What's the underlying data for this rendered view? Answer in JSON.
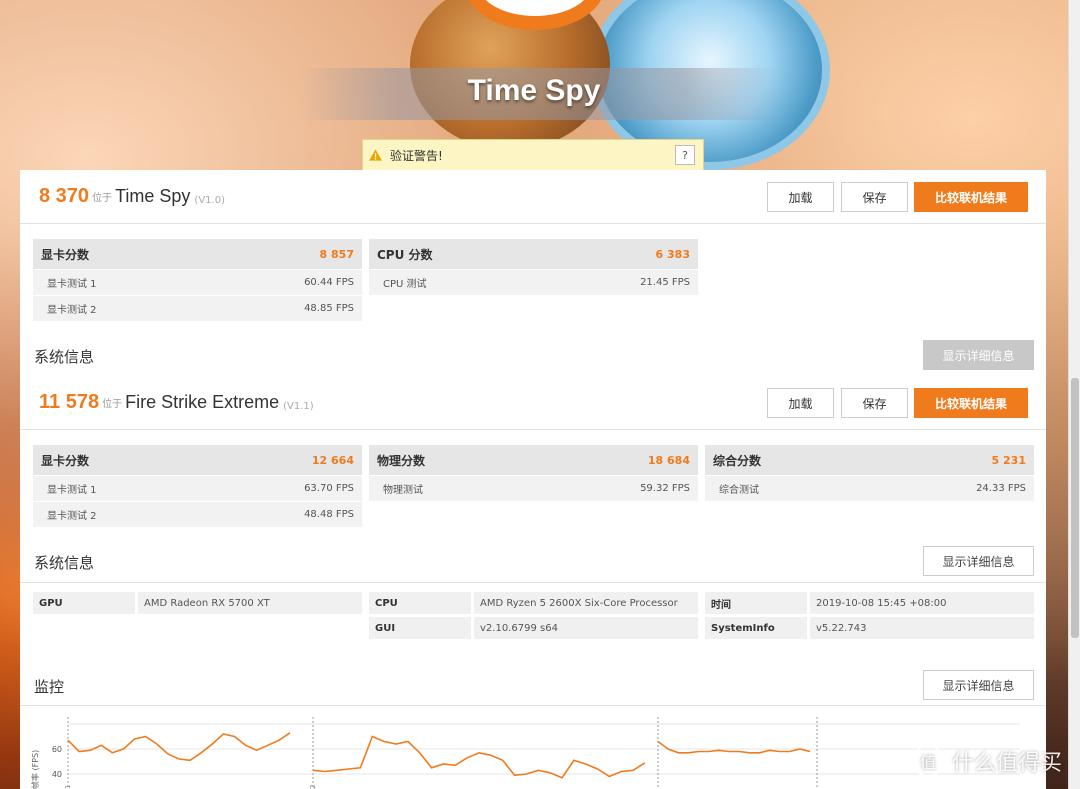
{
  "hero": {
    "title": "Time Spy"
  },
  "warning": {
    "text": "验证警告!",
    "help": "?"
  },
  "panels": [
    {
      "score": "8 370",
      "position_word": "位于",
      "test_name": "Time Spy",
      "version": "(V1.0)",
      "buttons": {
        "load": "加载",
        "save": "保存",
        "compare": "比较联机结果"
      },
      "score_boxes": [
        {
          "title": "显卡分数",
          "value": "8 857",
          "rows": [
            {
              "label": "显卡测试 1",
              "value": "60.44 FPS"
            },
            {
              "label": "显卡测试 2",
              "value": "48.85 FPS"
            }
          ]
        },
        {
          "title": "CPU 分数",
          "value": "6 383",
          "rows": [
            {
              "label": "CPU 测试",
              "value": "21.45 FPS"
            }
          ]
        }
      ],
      "system_info_title": "系统信息",
      "detail_button": "显示详细信息"
    },
    {
      "score": "11 578",
      "position_word": "位于",
      "test_name": "Fire Strike Extreme",
      "version": "(V1.1)",
      "buttons": {
        "load": "加载",
        "save": "保存",
        "compare": "比较联机结果"
      },
      "score_boxes": [
        {
          "title": "显卡分数",
          "value": "12 664",
          "rows": [
            {
              "label": "显卡测试 1",
              "value": "63.70 FPS"
            },
            {
              "label": "显卡测试 2",
              "value": "48.48 FPS"
            }
          ]
        },
        {
          "title": "物理分数",
          "value": "18 684",
          "rows": [
            {
              "label": "物理测试",
              "value": "59.32 FPS"
            }
          ]
        },
        {
          "title": "综合分数",
          "value": "5 231",
          "rows": [
            {
              "label": "综合测试",
              "value": "24.33 FPS"
            }
          ]
        }
      ],
      "system_info_title": "系统信息",
      "detail_button": "显示详细信息",
      "system_info": [
        {
          "key": "GPU",
          "value": "AMD Radeon RX 5700 XT"
        },
        {
          "key": "CPU",
          "value": "AMD Ryzen 5 2600X Six-Core Processor"
        },
        {
          "key": "GUI",
          "value": "v2.10.6799 s64"
        },
        {
          "key": "时间",
          "value": "2019-10-08 15:45 +08:00"
        },
        {
          "key": "SystemInfo",
          "value": "v5.22.743"
        }
      ],
      "monitor_title": "监控",
      "monitor_detail_button": "显示详细信息"
    }
  ],
  "chart_data": {
    "type": "line",
    "ylabel": "帧率 (FPS)",
    "yticks": [
      40,
      60
    ],
    "segments": [
      {
        "label": "1",
        "values": [
          67,
          58,
          59,
          63,
          57,
          60,
          68,
          70,
          64,
          56,
          52,
          51,
          57,
          64,
          72,
          70,
          63,
          59,
          63,
          67,
          73
        ]
      },
      {
        "label": "2",
        "values": [
          43,
          42,
          43,
          44,
          45,
          70,
          66,
          64,
          66,
          57,
          45,
          48,
          47,
          53,
          57,
          55,
          51,
          39,
          40,
          43,
          41,
          37,
          51,
          48,
          44,
          38,
          42,
          43,
          49
        ]
      },
      {
        "label": "",
        "values": [
          66,
          60,
          57,
          57,
          58,
          58,
          59,
          58,
          58,
          57,
          57,
          59,
          58,
          58,
          60,
          58
        ]
      }
    ],
    "color": "#f07b1d"
  },
  "watermark": {
    "text": "什么值得买"
  }
}
